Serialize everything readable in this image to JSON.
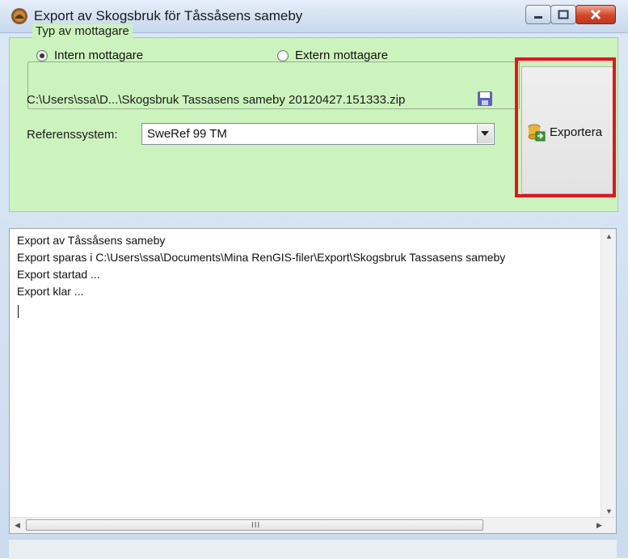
{
  "window": {
    "title": "Export av Skogsbruk för Tåssåsens sameby",
    "controls": {
      "minimize": "minimize",
      "maximize": "maximize",
      "close": "close"
    }
  },
  "recipient_group": {
    "legend": "Typ av mottagare",
    "options": [
      {
        "label": "Intern mottagare",
        "selected": true
      },
      {
        "label": "Extern mottagare",
        "selected": false
      }
    ]
  },
  "output": {
    "path": "C:\\Users\\ssa\\D...\\Skogsbruk Tassasens sameby 20120427.151333.zip"
  },
  "reference_system": {
    "label": "Referenssystem:",
    "value": "SweRef 99 TM"
  },
  "export_button": {
    "label": "Exportera",
    "highlight_color": "#e4141e"
  },
  "log": {
    "lines": [
      "Export av Tåssåsens sameby",
      "Export sparas i  C:\\Users\\ssa\\Documents\\Mina RenGIS-filer\\Export\\Skogsbruk Tassasens sameby",
      "Export startad ...",
      "Export klar ..."
    ],
    "scroll_grip": "III"
  },
  "colors": {
    "panel_green": "#ccf3bd",
    "title_bar": "#d2e0f1"
  }
}
